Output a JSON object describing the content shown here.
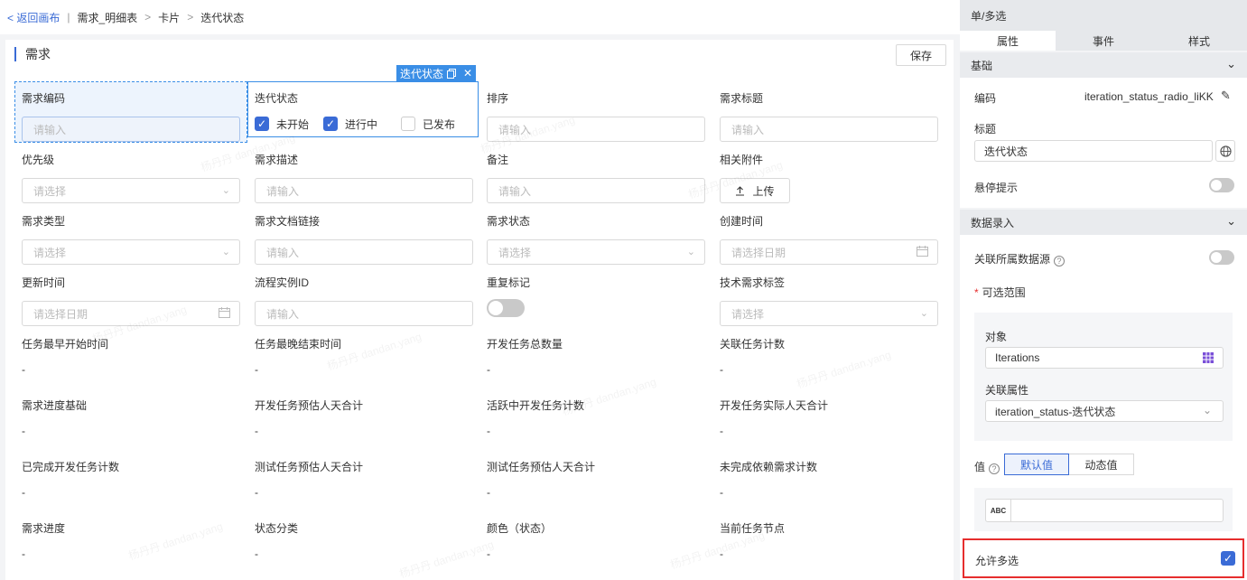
{
  "breadcrumb": {
    "back": "< 返回画布",
    "sep": "|",
    "items": [
      "需求_明细表",
      "卡片",
      "迭代状态"
    ],
    "arrow": ">"
  },
  "main": {
    "title": "需求",
    "save_label": "保存",
    "selected_tag": "迭代状态",
    "fields": [
      {
        "label": "需求编码",
        "type": "input",
        "placeholder": "请输入"
      },
      {
        "label": "迭代状态",
        "type": "checkbox",
        "options": [
          {
            "label": "未开始",
            "checked": true
          },
          {
            "label": "进行中",
            "checked": true
          },
          {
            "label": "已发布",
            "checked": false
          }
        ]
      },
      {
        "label": "排序",
        "type": "input",
        "placeholder": "请输入"
      },
      {
        "label": "需求标题",
        "type": "input",
        "placeholder": "请输入"
      },
      {
        "label": "优先级",
        "type": "select",
        "placeholder": "请选择"
      },
      {
        "label": "需求描述",
        "type": "input",
        "placeholder": "请输入"
      },
      {
        "label": "备注",
        "type": "input",
        "placeholder": "请输入"
      },
      {
        "label": "相关附件",
        "type": "upload",
        "button": "上传"
      },
      {
        "label": "需求类型",
        "type": "select",
        "placeholder": "请选择"
      },
      {
        "label": "需求文档链接",
        "type": "input",
        "placeholder": "请输入"
      },
      {
        "label": "需求状态",
        "type": "select",
        "placeholder": "请选择"
      },
      {
        "label": "创建时间",
        "type": "date",
        "placeholder": "请选择日期"
      },
      {
        "label": "更新时间",
        "type": "date",
        "placeholder": "请选择日期"
      },
      {
        "label": "流程实例ID",
        "type": "input",
        "placeholder": "请输入"
      },
      {
        "label": "重复标记",
        "type": "toggle"
      },
      {
        "label": "技术需求标签",
        "type": "select",
        "placeholder": "请选择"
      },
      {
        "label": "任务最早开始时间",
        "type": "text",
        "value": "-"
      },
      {
        "label": "任务最晚结束时间",
        "type": "text",
        "value": "-"
      },
      {
        "label": "开发任务总数量",
        "type": "text",
        "value": "-"
      },
      {
        "label": "关联任务计数",
        "type": "text",
        "value": "-"
      },
      {
        "label": "需求进度基础",
        "type": "text",
        "value": "-"
      },
      {
        "label": "开发任务预估人天合计",
        "type": "text",
        "value": "-"
      },
      {
        "label": "活跃中开发任务计数",
        "type": "text",
        "value": "-"
      },
      {
        "label": "开发任务实际人天合计",
        "type": "text",
        "value": "-"
      },
      {
        "label": "已完成开发任务计数",
        "type": "text",
        "value": "-"
      },
      {
        "label": "测试任务预估人天合计",
        "type": "text",
        "value": "-"
      },
      {
        "label": "测试任务预估人天合计",
        "type": "text",
        "value": "-"
      },
      {
        "label": "未完成依赖需求计数",
        "type": "text",
        "value": "-"
      },
      {
        "label": "需求进度",
        "type": "text",
        "value": "-"
      },
      {
        "label": "状态分类",
        "type": "text",
        "value": "-"
      },
      {
        "label": "颜色（状态）",
        "type": "text",
        "value": "-"
      },
      {
        "label": "当前任务节点",
        "type": "text",
        "value": "-"
      }
    ]
  },
  "panel": {
    "title": "单/多选",
    "tabs": [
      "属性",
      "事件",
      "样式"
    ],
    "basic": {
      "header": "基础",
      "code_label": "编码",
      "code_value": "iteration_status_radio_liKK",
      "title_label": "标题",
      "title_value": "迭代状态",
      "tooltip_label": "悬停提示"
    },
    "data_entry": {
      "header": "数据录入",
      "link_source_label": "关联所属数据源",
      "range_label": "可选范围",
      "required_mark": "*",
      "object_label": "对象",
      "object_value": "Iterations",
      "attr_label": "关联属性",
      "attr_value": "iteration_status-迭代状态",
      "value_label": "值",
      "default_btn": "默认值",
      "dynamic_btn": "动态值",
      "abc": "ABC",
      "allow_multi_label": "允许多选"
    }
  },
  "watermark": "杨丹丹 dandan.yang",
  "colors": {
    "accent": "#3a6bd6",
    "highlight": "#3a8ee6",
    "alert": "#e62e2e"
  }
}
